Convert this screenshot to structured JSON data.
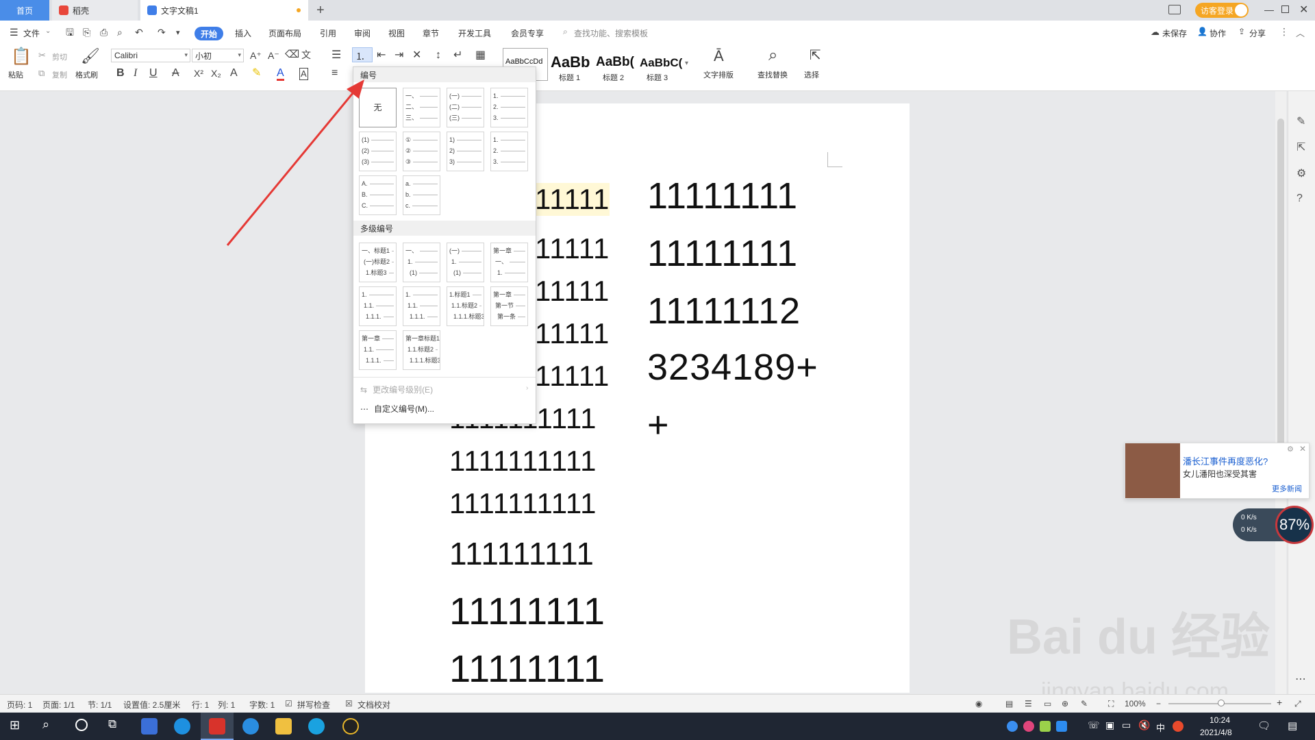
{
  "tabs": [
    {
      "label": "首页"
    },
    {
      "label": "稻壳"
    },
    {
      "label": "文字文稿1"
    }
  ],
  "tabbar_right": {
    "login": "访客登录"
  },
  "menu": {
    "file": "文件",
    "start": "开始",
    "items": [
      "插入",
      "页面布局",
      "引用",
      "审阅",
      "视图",
      "章节",
      "开发工具",
      "会员专享"
    ],
    "search_placeholder": "查找功能、搜索模板",
    "unsaved": "未保存",
    "collab": "协作",
    "share": "分享"
  },
  "toolbar": {
    "paste": "粘贴",
    "cut": "剪切",
    "copy": "复制",
    "format_painter": "格式刷",
    "font_name": "Calibri",
    "font_size": "小初",
    "styles": [
      {
        "preview": "AaBbCcDd",
        "label": ""
      },
      {
        "preview": "AaBb",
        "label": "标题 1"
      },
      {
        "preview": "AaBb(",
        "label": "标题 2"
      },
      {
        "preview": "AaBbC(",
        "label": "标题 3"
      }
    ],
    "text_layout": "文字排版",
    "find_replace": "查找替换",
    "select": "选择"
  },
  "numbering_menu": {
    "header": "编号",
    "none": "无",
    "single": [
      [
        "一、",
        "二、",
        "三、"
      ],
      [
        "(一)",
        "(二)",
        "(三)"
      ],
      [
        "1.",
        "2.",
        "3."
      ],
      [
        "(1)",
        "(2)",
        "(3)"
      ],
      [
        "①",
        "②",
        "③"
      ],
      [
        "1)",
        "2)",
        "3)"
      ],
      [
        "1.",
        "2.",
        "3."
      ],
      [
        "A.",
        "B.",
        "C."
      ],
      [
        "a.",
        "b.",
        "c."
      ]
    ],
    "multi_header": "多级编号",
    "multi": [
      [
        "一、标题1",
        "(一)标题2",
        "1.标题3"
      ],
      [
        "一、",
        "1.",
        "(1)"
      ],
      [
        "(一)",
        "1.",
        "(1)"
      ],
      [
        "第一章",
        "一、",
        "1."
      ],
      [
        "1.",
        "1.1.",
        "1.1.1."
      ],
      [
        "1.",
        "1.1.",
        "1.1.1."
      ],
      [
        "1.标题1",
        "1.1.标题2",
        "1.1.1.标题3"
      ],
      [
        "第一章",
        "第一节",
        "第一条"
      ],
      [
        "第一章",
        "1.1.",
        "1.1.1."
      ],
      [
        "第一章标题1",
        "1.1.标题2",
        "1.1.1.标题3"
      ]
    ],
    "change_level": "更改编号级别(E)",
    "custom": "自定义编号(M)..."
  },
  "document": {
    "left_column": [
      "11111",
      "11111",
      "11111",
      "11111",
      "11111",
      "1111111111",
      "1111111111",
      "1111111111",
      "111111111",
      "11111111",
      "11111111"
    ],
    "right_column": [
      "11111111",
      "11111111",
      "11111112",
      "3234189+",
      "+"
    ]
  },
  "news_popup": {
    "title": "潘长江事件再度恶化?",
    "subtitle": "女儿潘阳也深受其害",
    "more": "更多新闻"
  },
  "net_speed": {
    "up": "0 K/s",
    "down": "0 K/s",
    "percent": "87%"
  },
  "statusbar": {
    "page_no": "页码: 1",
    "page": "页面: 1/1",
    "section": "节: 1/1",
    "setting": "设置值: 2.5厘米",
    "row": "行: 1",
    "col": "列: 1",
    "words": "字数: 1",
    "spell": "拼写检查",
    "proof": "文档校对",
    "zoom": "100%"
  },
  "taskbar": {
    "ime": "中",
    "time": "10:24",
    "date": "2021/4/8"
  },
  "watermark": {
    "logo": "Bai du 经验",
    "url": "jingyan.baidu.com"
  },
  "colors": {
    "accent": "#3f7ee8",
    "arrow": "#e53935",
    "taskbar": "#1f2633"
  }
}
